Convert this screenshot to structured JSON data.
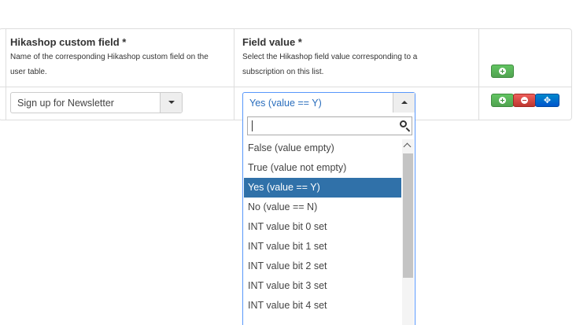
{
  "table": {
    "col1": {
      "title": "Hikashop custom field *",
      "desc_line1": "Name of the corresponding Hikashop custom field on the",
      "desc_line2": "user table."
    },
    "col2": {
      "title": "Field value *",
      "desc_line1": "Select the Hikashop field value corresponding to a",
      "desc_line2": "subscription on this list."
    }
  },
  "row": {
    "custom_field_value": "Sign up for Newsletter",
    "field_value": "Yes (value == Y)"
  },
  "dropdown": {
    "search_value": "",
    "options": [
      "False (value empty)",
      "True (value not empty)",
      "Yes (value == Y)",
      "No (value == N)",
      "INT value bit 0 set",
      "INT value bit 1 set",
      "INT value bit 2 set",
      "INT value bit 3 set",
      "INT value bit 4 set"
    ],
    "selected_index": 2
  },
  "icons": {
    "add": "plus-circle-icon",
    "remove": "minus-circle-icon",
    "move": "move-arrows-icon",
    "search": "search-icon"
  },
  "colors": {
    "green": "#5bb75b",
    "red": "#da4f49",
    "blue": "#006dcc",
    "selected_option": "#3071a9"
  }
}
